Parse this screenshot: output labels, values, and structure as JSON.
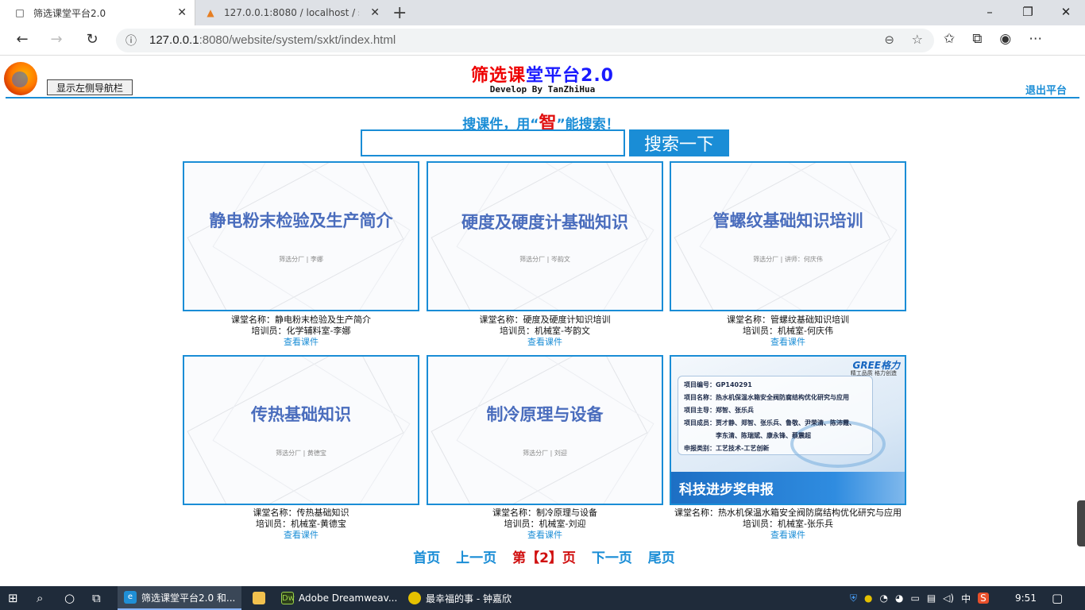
{
  "browser": {
    "tabs": [
      {
        "title": "筛选课堂平台2.0",
        "active": true
      },
      {
        "title": "127.0.0.1:8080 / localhost / sxkt /",
        "active": false
      }
    ],
    "url_host": "127.0.0.1",
    "url_rest": ":8080/website/system/sxkt/index.html"
  },
  "header": {
    "title_part1": "筛选课",
    "title_part2": "堂平台2.0",
    "subtitle": "Develop By TanZhiHua",
    "sidebar_button": "显示左侧导航栏",
    "logout": "退出平台"
  },
  "search": {
    "label_before": "搜课件，用“",
    "label_highlight": "智",
    "label_after": "”能搜索！",
    "input_value": "",
    "button": "搜索一下"
  },
  "courses": [
    {
      "slide_title": "静电粉末检验及生产简介",
      "slide_sub": "筛选分厂  |  李娜",
      "name_label": "课堂名称：",
      "name": "静电粉末检验及生产简介",
      "trainer_label": "培训员：",
      "trainer": "化学辅料室-李娜",
      "link": "查看课件"
    },
    {
      "slide_title": "硬度及硬度计基础知识",
      "slide_sub": "筛选分厂  |  岑韵文",
      "name_label": "课堂名称：",
      "name": "硬度及硬度计知识培训",
      "trainer_label": "培训员：",
      "trainer": "机械室-岑韵文",
      "link": "查看课件"
    },
    {
      "slide_title": "管螺纹基础知识培训",
      "slide_sub": "筛选分厂  |  讲师：何庆伟",
      "name_label": "课堂名称：",
      "name": "管螺纹基础知识培训",
      "trainer_label": "培训员：",
      "trainer": "机械室-何庆伟",
      "link": "查看课件"
    },
    {
      "slide_title": "传热基础知识",
      "slide_sub": "筛选分厂  |  黄德宝",
      "name_label": "课堂名称：",
      "name": "传热基础知识",
      "trainer_label": "培训员：",
      "trainer": "机械室-黄德宝",
      "link": "查看课件"
    },
    {
      "slide_title": "制冷原理与设备",
      "slide_sub": "筛选分厂  |  刘迎",
      "name_label": "课堂名称：",
      "name": "制冷原理与设备",
      "trainer_label": "培训员：",
      "trainer": "机械室-刘迎",
      "link": "查看课件"
    },
    {
      "name_label": "课堂名称：",
      "name": "热水机保温水箱安全阀防腐结构优化研究与应用",
      "trainer_label": "培训员：",
      "trainer": "机械室-张乐兵",
      "link": "查看课件"
    }
  ],
  "gree_slide": {
    "logo": "GREE格力",
    "tagline": "精工品质 格力创造",
    "lines": [
      "项目编号：GP140291",
      "项目名称：热水机保温水箱安全阀防腐结构优化研究与应用",
      "项目主导：郑智、张乐兵",
      "项目成员：贾才静、郑智、张乐兵、鲁敬、尹荣清、陈沛霞、",
      "李东清、陈瑞斌、康永锋、蔡震超",
      "申报类别：工艺技术-工艺创新"
    ],
    "banner": "科技进步奖申报"
  },
  "pagination": {
    "first": "首页",
    "prev": "上一页",
    "current_prefix": "第【",
    "current": "2",
    "current_suffix": "】页",
    "next": "下一页",
    "last": "尾页"
  },
  "taskbar": {
    "apps": [
      {
        "label": "筛选课堂平台2.0 和...",
        "active": true
      },
      {
        "label": "",
        "active": false
      },
      {
        "label": "Adobe Dreamweav...",
        "active": false
      },
      {
        "label": "最幸福的事 - 钟嘉欣",
        "active": false
      }
    ],
    "ime": "中",
    "time": "9:51"
  }
}
